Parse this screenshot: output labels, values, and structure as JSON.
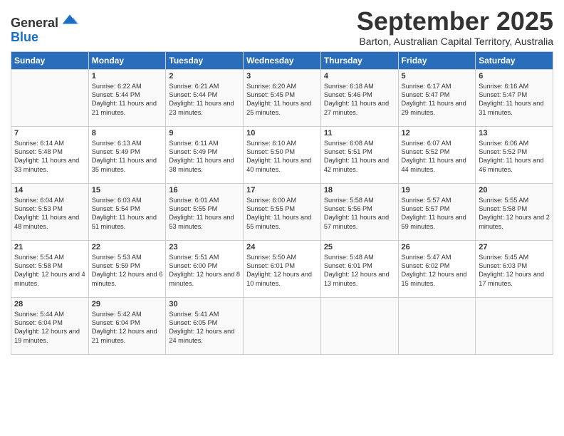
{
  "header": {
    "logo_line1": "General",
    "logo_line2": "Blue",
    "month": "September 2025",
    "location": "Barton, Australian Capital Territory, Australia"
  },
  "weekdays": [
    "Sunday",
    "Monday",
    "Tuesday",
    "Wednesday",
    "Thursday",
    "Friday",
    "Saturday"
  ],
  "weeks": [
    [
      {
        "day": "",
        "sunrise": "",
        "sunset": "",
        "daylight": ""
      },
      {
        "day": "1",
        "sunrise": "Sunrise: 6:22 AM",
        "sunset": "Sunset: 5:44 PM",
        "daylight": "Daylight: 11 hours and 21 minutes."
      },
      {
        "day": "2",
        "sunrise": "Sunrise: 6:21 AM",
        "sunset": "Sunset: 5:44 PM",
        "daylight": "Daylight: 11 hours and 23 minutes."
      },
      {
        "day": "3",
        "sunrise": "Sunrise: 6:20 AM",
        "sunset": "Sunset: 5:45 PM",
        "daylight": "Daylight: 11 hours and 25 minutes."
      },
      {
        "day": "4",
        "sunrise": "Sunrise: 6:18 AM",
        "sunset": "Sunset: 5:46 PM",
        "daylight": "Daylight: 11 hours and 27 minutes."
      },
      {
        "day": "5",
        "sunrise": "Sunrise: 6:17 AM",
        "sunset": "Sunset: 5:47 PM",
        "daylight": "Daylight: 11 hours and 29 minutes."
      },
      {
        "day": "6",
        "sunrise": "Sunrise: 6:16 AM",
        "sunset": "Sunset: 5:47 PM",
        "daylight": "Daylight: 11 hours and 31 minutes."
      }
    ],
    [
      {
        "day": "7",
        "sunrise": "Sunrise: 6:14 AM",
        "sunset": "Sunset: 5:48 PM",
        "daylight": "Daylight: 11 hours and 33 minutes."
      },
      {
        "day": "8",
        "sunrise": "Sunrise: 6:13 AM",
        "sunset": "Sunset: 5:49 PM",
        "daylight": "Daylight: 11 hours and 35 minutes."
      },
      {
        "day": "9",
        "sunrise": "Sunrise: 6:11 AM",
        "sunset": "Sunset: 5:49 PM",
        "daylight": "Daylight: 11 hours and 38 minutes."
      },
      {
        "day": "10",
        "sunrise": "Sunrise: 6:10 AM",
        "sunset": "Sunset: 5:50 PM",
        "daylight": "Daylight: 11 hours and 40 minutes."
      },
      {
        "day": "11",
        "sunrise": "Sunrise: 6:08 AM",
        "sunset": "Sunset: 5:51 PM",
        "daylight": "Daylight: 11 hours and 42 minutes."
      },
      {
        "day": "12",
        "sunrise": "Sunrise: 6:07 AM",
        "sunset": "Sunset: 5:52 PM",
        "daylight": "Daylight: 11 hours and 44 minutes."
      },
      {
        "day": "13",
        "sunrise": "Sunrise: 6:06 AM",
        "sunset": "Sunset: 5:52 PM",
        "daylight": "Daylight: 11 hours and 46 minutes."
      }
    ],
    [
      {
        "day": "14",
        "sunrise": "Sunrise: 6:04 AM",
        "sunset": "Sunset: 5:53 PM",
        "daylight": "Daylight: 11 hours and 48 minutes."
      },
      {
        "day": "15",
        "sunrise": "Sunrise: 6:03 AM",
        "sunset": "Sunset: 5:54 PM",
        "daylight": "Daylight: 11 hours and 51 minutes."
      },
      {
        "day": "16",
        "sunrise": "Sunrise: 6:01 AM",
        "sunset": "Sunset: 5:55 PM",
        "daylight": "Daylight: 11 hours and 53 minutes."
      },
      {
        "day": "17",
        "sunrise": "Sunrise: 6:00 AM",
        "sunset": "Sunset: 5:55 PM",
        "daylight": "Daylight: 11 hours and 55 minutes."
      },
      {
        "day": "18",
        "sunrise": "Sunrise: 5:58 AM",
        "sunset": "Sunset: 5:56 PM",
        "daylight": "Daylight: 11 hours and 57 minutes."
      },
      {
        "day": "19",
        "sunrise": "Sunrise: 5:57 AM",
        "sunset": "Sunset: 5:57 PM",
        "daylight": "Daylight: 11 hours and 59 minutes."
      },
      {
        "day": "20",
        "sunrise": "Sunrise: 5:55 AM",
        "sunset": "Sunset: 5:58 PM",
        "daylight": "Daylight: 12 hours and 2 minutes."
      }
    ],
    [
      {
        "day": "21",
        "sunrise": "Sunrise: 5:54 AM",
        "sunset": "Sunset: 5:58 PM",
        "daylight": "Daylight: 12 hours and 4 minutes."
      },
      {
        "day": "22",
        "sunrise": "Sunrise: 5:53 AM",
        "sunset": "Sunset: 5:59 PM",
        "daylight": "Daylight: 12 hours and 6 minutes."
      },
      {
        "day": "23",
        "sunrise": "Sunrise: 5:51 AM",
        "sunset": "Sunset: 6:00 PM",
        "daylight": "Daylight: 12 hours and 8 minutes."
      },
      {
        "day": "24",
        "sunrise": "Sunrise: 5:50 AM",
        "sunset": "Sunset: 6:01 PM",
        "daylight": "Daylight: 12 hours and 10 minutes."
      },
      {
        "day": "25",
        "sunrise": "Sunrise: 5:48 AM",
        "sunset": "Sunset: 6:01 PM",
        "daylight": "Daylight: 12 hours and 13 minutes."
      },
      {
        "day": "26",
        "sunrise": "Sunrise: 5:47 AM",
        "sunset": "Sunset: 6:02 PM",
        "daylight": "Daylight: 12 hours and 15 minutes."
      },
      {
        "day": "27",
        "sunrise": "Sunrise: 5:45 AM",
        "sunset": "Sunset: 6:03 PM",
        "daylight": "Daylight: 12 hours and 17 minutes."
      }
    ],
    [
      {
        "day": "28",
        "sunrise": "Sunrise: 5:44 AM",
        "sunset": "Sunset: 6:04 PM",
        "daylight": "Daylight: 12 hours and 19 minutes."
      },
      {
        "day": "29",
        "sunrise": "Sunrise: 5:42 AM",
        "sunset": "Sunset: 6:04 PM",
        "daylight": "Daylight: 12 hours and 21 minutes."
      },
      {
        "day": "30",
        "sunrise": "Sunrise: 5:41 AM",
        "sunset": "Sunset: 6:05 PM",
        "daylight": "Daylight: 12 hours and 24 minutes."
      },
      {
        "day": "",
        "sunrise": "",
        "sunset": "",
        "daylight": ""
      },
      {
        "day": "",
        "sunrise": "",
        "sunset": "",
        "daylight": ""
      },
      {
        "day": "",
        "sunrise": "",
        "sunset": "",
        "daylight": ""
      },
      {
        "day": "",
        "sunrise": "",
        "sunset": "",
        "daylight": ""
      }
    ]
  ]
}
